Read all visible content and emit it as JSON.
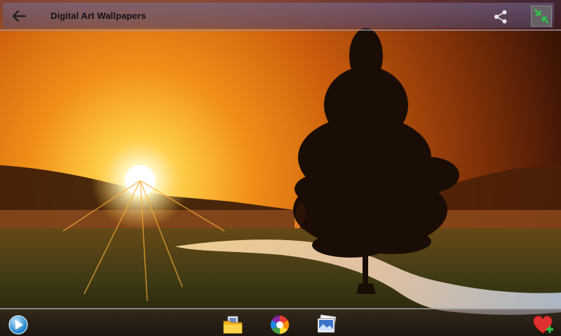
{
  "header": {
    "title": "Digital Art Wallpapers",
    "back_icon": "arrow-left-icon",
    "share_icon": "share-icon",
    "fullscreen_icon": "fullscreen-toggle-icon"
  },
  "toolbar": {
    "items": [
      {
        "icon": "play-slideshow-icon"
      },
      {
        "icon": "folder-save-icon"
      },
      {
        "icon": "color-wheel-icon"
      },
      {
        "icon": "set-wallpaper-icon"
      },
      {
        "icon": "favorite-add-icon"
      }
    ]
  },
  "colors": {
    "accent_green": "#2fc24a",
    "heart_red": "#e03030",
    "sky_orange": "#e86a10"
  }
}
